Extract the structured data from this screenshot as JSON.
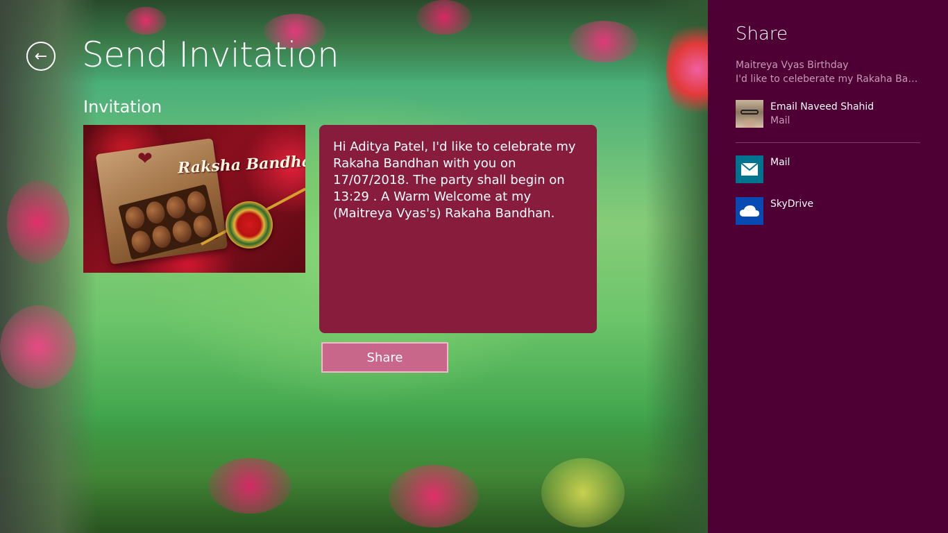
{
  "app": {
    "title": "Send Invitation",
    "section_title": "Invitation",
    "image_caption": "Raksha Bandhan",
    "message": "Hi Aditya Patel, I'd like to celebrate my Rakaha Bandhan with you on 17/07/2018. The party shall begin on 13:29 . A Warm Welcome at my (Maitreya Vyas's) Rakaha Bandhan.",
    "share_button_label": "Share",
    "back_icon": "back-arrow-icon"
  },
  "share_pane": {
    "title": "Share",
    "subject": "Maitreya Vyas Birthday",
    "description": "I'd like to celeberate my Rakaha Bandhan with you",
    "contact": {
      "name": "Email Naveed Shahid",
      "app": "Mail"
    },
    "apps": [
      {
        "label": "Mail",
        "icon": "mail-icon",
        "color": "#00738f"
      },
      {
        "label": "SkyDrive",
        "icon": "skydrive-cloud-icon",
        "color": "#094ab2"
      }
    ],
    "background": "#4e0034"
  },
  "colors": {
    "message_box": "#881c3d",
    "share_button": "#c8678a"
  }
}
